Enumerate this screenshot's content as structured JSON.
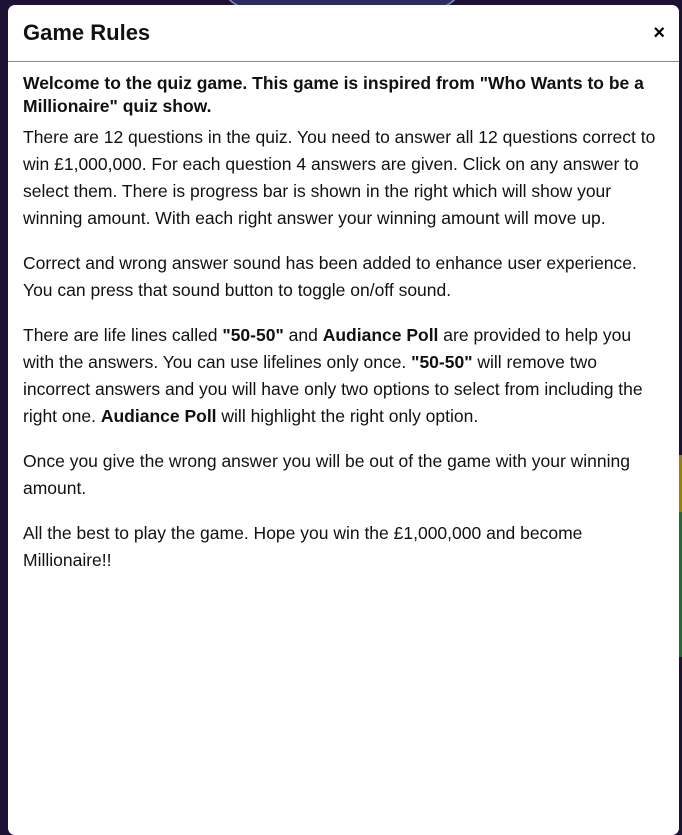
{
  "modal": {
    "title": "Game Rules",
    "close_label": "×",
    "intro": "Welcome to the quiz game. This game is inspired from \"Who Wants to be a Millionaire\" quiz show.",
    "p1": "There are 12 questions in the quiz. You need to answer all 12 questions correct to win £1,000,000. For each question 4 answers are given. Click on any answer to select them. There is progress bar is shown in the right which will show your winning amount. With each right answer your winning amount will move up.",
    "p2": "Correct and wrong answer sound has been added to enhance user experience. You can press that sound button to toggle on/off sound.",
    "p3": {
      "t1": "There are life lines called ",
      "b1": "\"50-50\"",
      "t2": " and ",
      "b2": "Audiance Poll",
      "t3": " are provided to help you with the answers. You can use lifelines only once. ",
      "b3": "\"50-50\"",
      "t4": " will remove two incorrect answers and you will have only two options to select from including the right one. ",
      "b4": "Audiance Poll",
      "t5": " will highlight the right only option."
    },
    "p4": "Once you give the wrong answer you will be out of the game with your winning amount.",
    "p5": "All the best to play the game. Hope you win the £1,000,000 and become Millionaire!!"
  },
  "colors": {
    "backdrop": "#1e1234",
    "modal": "#ffffff"
  }
}
